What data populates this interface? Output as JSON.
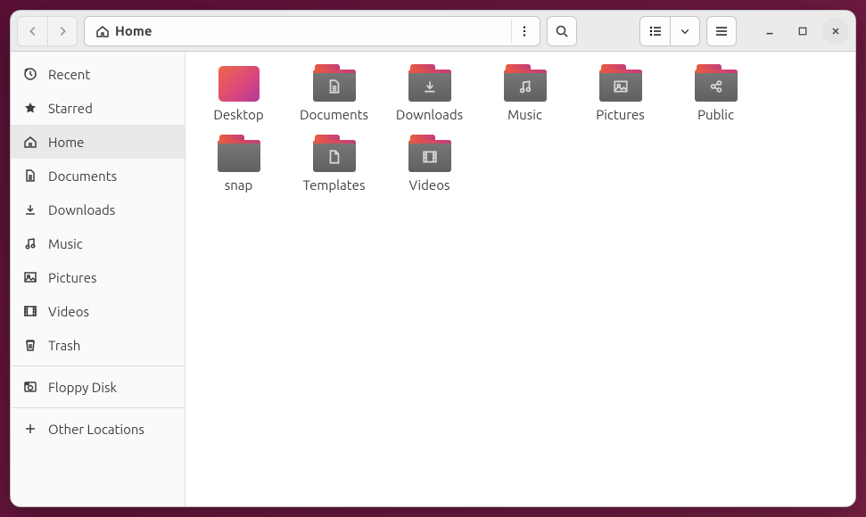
{
  "breadcrumb": {
    "label": "Home"
  },
  "sidebar": [
    {
      "icon": "recent",
      "label": "Recent"
    },
    {
      "icon": "star",
      "label": "Starred"
    },
    {
      "icon": "home",
      "label": "Home",
      "selected": true
    },
    {
      "icon": "doc",
      "label": "Documents"
    },
    {
      "icon": "download",
      "label": "Downloads"
    },
    {
      "icon": "music",
      "label": "Music"
    },
    {
      "icon": "picture",
      "label": "Pictures"
    },
    {
      "icon": "video",
      "label": "Videos"
    },
    {
      "icon": "trash",
      "label": "Trash"
    },
    {
      "sep": true
    },
    {
      "icon": "floppy",
      "label": "Floppy Disk"
    },
    {
      "sep": true
    },
    {
      "icon": "plus",
      "label": "Other Locations"
    }
  ],
  "items": [
    {
      "kind": "desktop",
      "label": "Desktop"
    },
    {
      "kind": "folder",
      "glyph": "doc",
      "label": "Documents"
    },
    {
      "kind": "folder",
      "glyph": "download",
      "label": "Downloads"
    },
    {
      "kind": "folder",
      "glyph": "music",
      "label": "Music"
    },
    {
      "kind": "folder",
      "glyph": "picture",
      "label": "Pictures"
    },
    {
      "kind": "folder",
      "glyph": "share",
      "label": "Public"
    },
    {
      "kind": "folder",
      "glyph": "",
      "label": "snap"
    },
    {
      "kind": "folder",
      "glyph": "template",
      "label": "Templates"
    },
    {
      "kind": "folder",
      "glyph": "video",
      "label": "Videos"
    }
  ]
}
